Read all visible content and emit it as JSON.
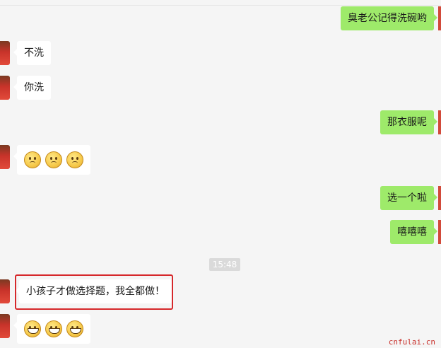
{
  "messages": [
    {
      "side": "right",
      "text": "臭老公记得洗碗哟"
    },
    {
      "side": "left",
      "text": "不洗"
    },
    {
      "side": "left",
      "text": "你洗"
    },
    {
      "side": "right",
      "text": "那衣服呢"
    },
    {
      "side": "left",
      "emoji": "sad-face",
      "count": 3
    },
    {
      "side": "right",
      "text": "选一个啦"
    },
    {
      "side": "right",
      "text": "嘻嘻嘻"
    },
    {
      "side": "left",
      "text": "小孩子才做选择题，我全都做！",
      "highlighted": true
    },
    {
      "side": "left",
      "emoji": "grin-face",
      "count": 3
    }
  ],
  "timestamp": "15:48",
  "watermark": "cnfulai.cn",
  "colors": {
    "right_bubble": "#9eea6a",
    "left_bubble": "#ffffff",
    "highlight": "#d6282b",
    "background": "#f5f5f5"
  }
}
